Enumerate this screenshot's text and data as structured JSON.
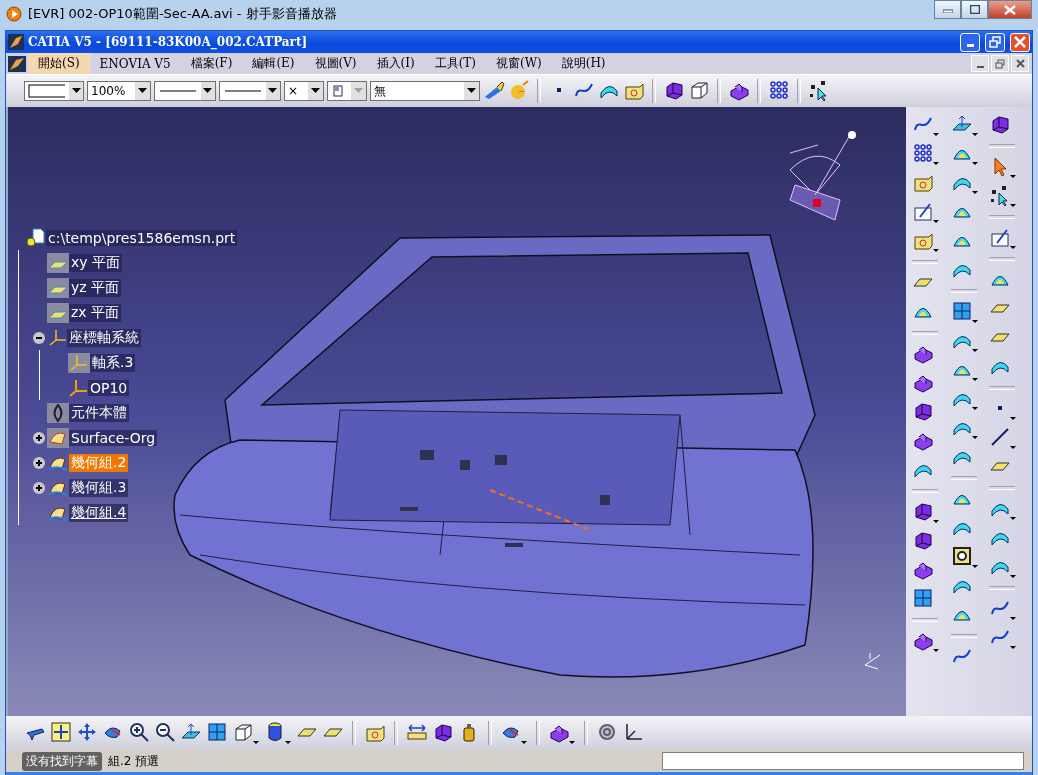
{
  "player": {
    "title": "[EVR] 002-OP10範圍-Sec-AA.avi - 射手影音播放器",
    "toast": "没有找到字幕"
  },
  "window": {
    "title": "CATIA V5 - [69111-83K00A_002.CATPart]"
  },
  "menu": [
    {
      "label": "開始(S)",
      "selected": true
    },
    {
      "label": "ENOVIA V5",
      "selected": false
    },
    {
      "label": "檔案(F)",
      "selected": false
    },
    {
      "label": "編輯(E)",
      "selected": false
    },
    {
      "label": "視圖(V)",
      "selected": false
    },
    {
      "label": "插入(I)",
      "selected": false
    },
    {
      "label": "工具(T)",
      "selected": false
    },
    {
      "label": "視窗(W)",
      "selected": false
    },
    {
      "label": "說明(H)",
      "selected": false
    }
  ],
  "toolbar": {
    "combos": [
      {
        "kind": "swatch",
        "disabled": false
      },
      {
        "kind": "text",
        "value": "100%",
        "disabled": false
      },
      {
        "kind": "line",
        "disabled": false
      },
      {
        "kind": "line",
        "disabled": false
      },
      {
        "kind": "text",
        "value": "×",
        "disabled": false
      },
      {
        "kind": "layer",
        "disabled": true
      },
      {
        "kind": "text",
        "value": "無",
        "disabled": false
      }
    ]
  },
  "tree": {
    "label": "c:\\temp\\pres1586emsn.prt",
    "kind": "part",
    "selected": false,
    "in_work": false,
    "children": [
      {
        "label": "xy 平面",
        "kind": "plane",
        "selected": false,
        "in_work": false
      },
      {
        "label": "yz 平面",
        "kind": "plane",
        "selected": false,
        "in_work": false
      },
      {
        "label": "zx 平面",
        "kind": "plane",
        "selected": false,
        "in_work": false
      },
      {
        "label": "座標軸系統",
        "kind": "axes",
        "selected": false,
        "in_work": false,
        "expanded": true,
        "children": [
          {
            "label": "軸系.3",
            "kind": "axis-hidden",
            "selected": false,
            "in_work": false
          },
          {
            "label": "OP10",
            "kind": "axis",
            "selected": false,
            "in_work": false
          }
        ]
      },
      {
        "label": "元件本體",
        "kind": "body",
        "selected": false,
        "in_work": false
      },
      {
        "label": "Surface-Org",
        "kind": "set-hidden",
        "selected": false,
        "in_work": false,
        "expanded": false
      },
      {
        "label": "幾何組.2",
        "kind": "set",
        "selected": true,
        "in_work": false,
        "expanded": false
      },
      {
        "label": "幾何組.3",
        "kind": "set",
        "selected": false,
        "in_work": false,
        "expanded": false
      },
      {
        "label": "幾何組.4",
        "kind": "set",
        "selected": false,
        "in_work": true
      }
    ]
  },
  "status_bar": {
    "text": "組.2 預選"
  }
}
